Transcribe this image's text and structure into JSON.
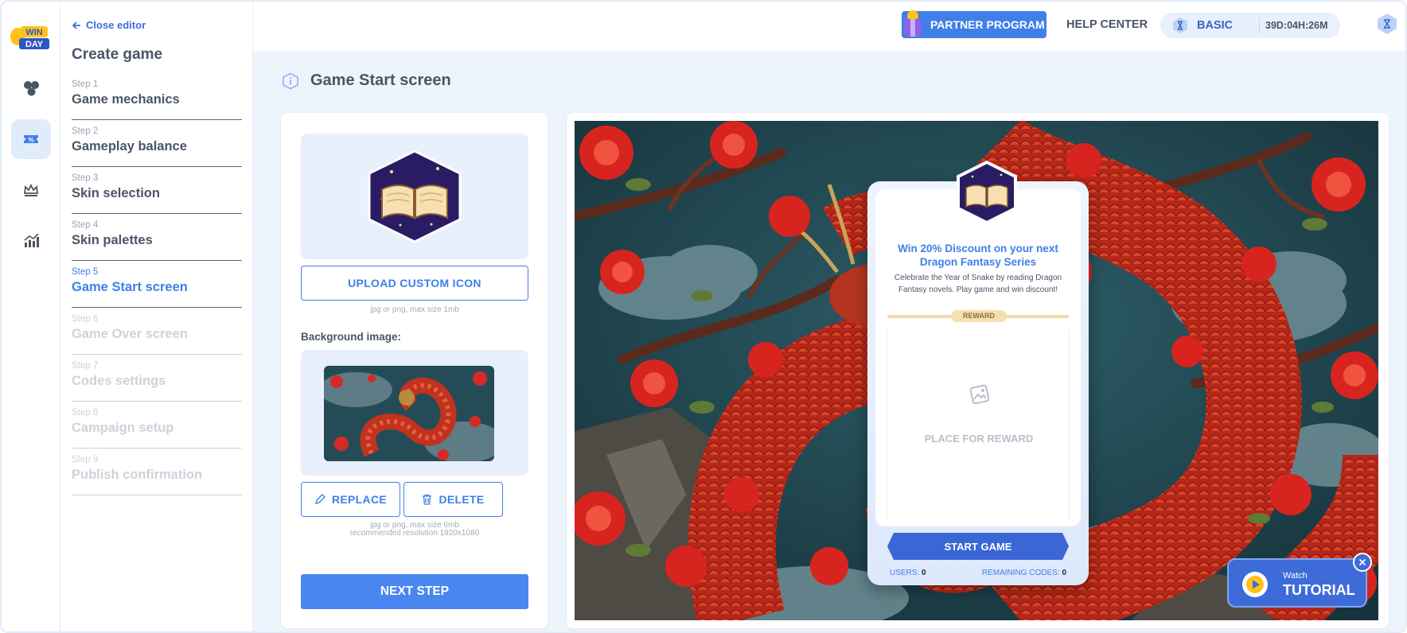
{
  "sidebar": {
    "close_editor": "Close editor",
    "title": "Create game",
    "steps": [
      {
        "num": "Step 1",
        "name": "Game mechanics",
        "state": "done"
      },
      {
        "num": "Step 2",
        "name": "Gameplay balance",
        "state": "done"
      },
      {
        "num": "Step 3",
        "name": "Skin selection",
        "state": "done"
      },
      {
        "num": "Step 4",
        "name": "Skin palettes",
        "state": "done"
      },
      {
        "num": "Step 5",
        "name": "Game Start screen",
        "state": "current"
      },
      {
        "num": "Step 6",
        "name": "Game Over screen",
        "state": "disabled"
      },
      {
        "num": "Step 7",
        "name": "Codes settings",
        "state": "disabled"
      },
      {
        "num": "Step 8",
        "name": "Campaign setup",
        "state": "disabled"
      },
      {
        "num": "Step 9",
        "name": "Publish confirmation",
        "state": "disabled"
      }
    ]
  },
  "rail": {
    "logo_text_top": "WIN",
    "logo_text_bottom": "DAY",
    "items": [
      "mechanics-icon",
      "coupon-icon",
      "crown-icon",
      "analytics-icon"
    ],
    "active_index": 1
  },
  "topbar": {
    "partner_label": "PARTNER PROGRAM",
    "help_label": "HELP CENTER",
    "plan": "BASIC",
    "timer": "39D:04H:26M"
  },
  "section": {
    "title": "Game Start screen"
  },
  "settings": {
    "upload_icon_label": "UPLOAD CUSTOM ICON",
    "upload_icon_hint": "jpg or png, max size 1mb",
    "background_label": "Background image:",
    "replace_label": "REPLACE",
    "delete_label": "DELETE",
    "bg_hint_1": "jpg or png, max size 6mb",
    "bg_hint_2": "recommended resolution 1920x1080",
    "next_label": "NEXT STEP"
  },
  "popup": {
    "title": "Win 20% Discount on your next Dragon Fantasy Series",
    "description": "Celebrate the Year of Snake by reading Dragon Fantasy novels. Play game and win discount!",
    "reward_tag": "REWARD",
    "reward_placeholder": "PLACE FOR REWARD",
    "start_label": "START GAME",
    "users_label": "USERS:",
    "users_value": "0",
    "codes_label": "REMAINING CODES:",
    "codes_value": "0"
  },
  "tutorial": {
    "watch": "Watch",
    "label": "TUTORIAL"
  },
  "colors": {
    "accent": "#3f7fe8",
    "dark_blue": "#3a66d6",
    "panel_bg": "#eef4fc",
    "text": "#4b5568"
  }
}
